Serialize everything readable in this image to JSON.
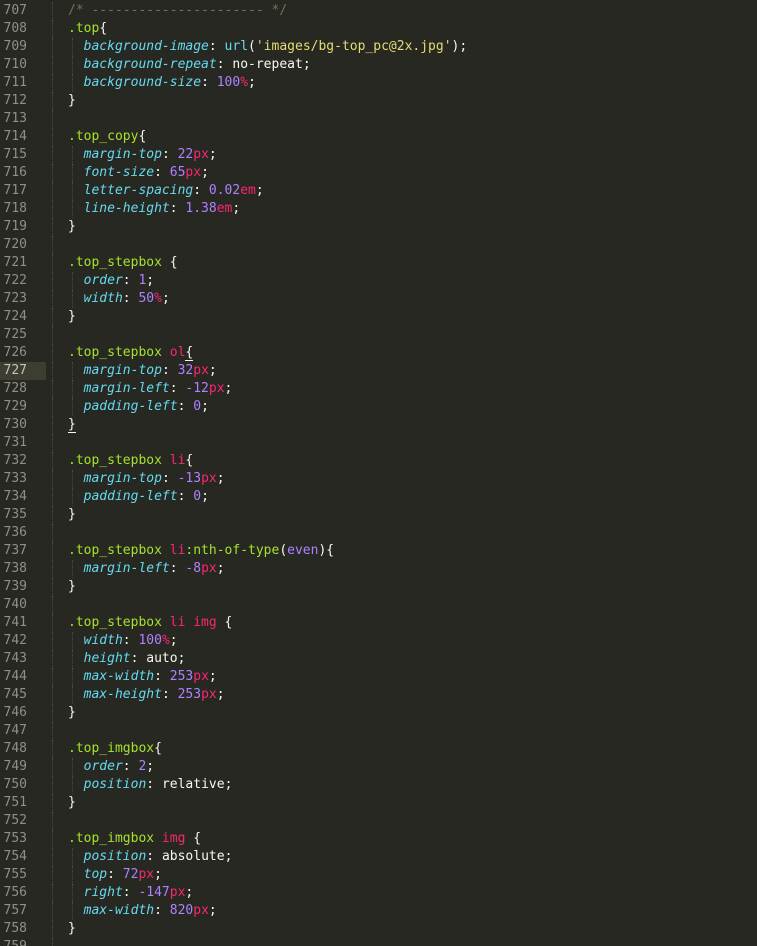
{
  "editor": {
    "colors": {
      "background": "#272822",
      "gutter_text": "#90908a",
      "active_line": "#3e3d32",
      "comment": "#75715e",
      "selector": "#a6e22e",
      "tag": "#f92672",
      "property": "#66d9ef",
      "number": "#ae81ff",
      "unit": "#f92672",
      "string": "#e6db74",
      "text": "#f8f8f2"
    },
    "active_line": 727,
    "lines": [
      {
        "n": "707",
        "tokens": [
          [
            "cm",
            "/* ---------------------- */"
          ]
        ]
      },
      {
        "n": "708",
        "tokens": [
          [
            "sel",
            ".top"
          ],
          [
            "p",
            "{"
          ]
        ]
      },
      {
        "n": "709",
        "tokens": [
          [
            "sp",
            "  "
          ],
          [
            "prop",
            "background-image"
          ],
          [
            "p",
            ": "
          ],
          [
            "fn",
            "url"
          ],
          [
            "p",
            "("
          ],
          [
            "str",
            "'images/bg-top_pc@2x.jpg'"
          ],
          [
            "p",
            ");"
          ]
        ]
      },
      {
        "n": "710",
        "tokens": [
          [
            "sp",
            "  "
          ],
          [
            "prop",
            "background-repeat"
          ],
          [
            "p",
            ": "
          ],
          [
            "val",
            "no-repeat"
          ],
          [
            "p",
            ";"
          ]
        ]
      },
      {
        "n": "711",
        "tokens": [
          [
            "sp",
            "  "
          ],
          [
            "prop",
            "background-size"
          ],
          [
            "p",
            ": "
          ],
          [
            "num",
            "100"
          ],
          [
            "unit",
            "%"
          ],
          [
            "p",
            ";"
          ]
        ]
      },
      {
        "n": "712",
        "tokens": [
          [
            "p",
            "}"
          ]
        ]
      },
      {
        "n": "713",
        "tokens": []
      },
      {
        "n": "714",
        "tokens": [
          [
            "sel",
            ".top_copy"
          ],
          [
            "p",
            "{"
          ]
        ]
      },
      {
        "n": "715",
        "tokens": [
          [
            "sp",
            "  "
          ],
          [
            "prop",
            "margin-top"
          ],
          [
            "p",
            ": "
          ],
          [
            "num",
            "22"
          ],
          [
            "unit",
            "px"
          ],
          [
            "p",
            ";"
          ]
        ]
      },
      {
        "n": "716",
        "tokens": [
          [
            "sp",
            "  "
          ],
          [
            "prop",
            "font-size"
          ],
          [
            "p",
            ": "
          ],
          [
            "num",
            "65"
          ],
          [
            "unit",
            "px"
          ],
          [
            "p",
            ";"
          ]
        ]
      },
      {
        "n": "717",
        "tokens": [
          [
            "sp",
            "  "
          ],
          [
            "prop",
            "letter-spacing"
          ],
          [
            "p",
            ": "
          ],
          [
            "num",
            "0.02"
          ],
          [
            "unit",
            "em"
          ],
          [
            "p",
            ";"
          ]
        ]
      },
      {
        "n": "718",
        "tokens": [
          [
            "sp",
            "  "
          ],
          [
            "prop",
            "line-height"
          ],
          [
            "p",
            ": "
          ],
          [
            "num",
            "1.38"
          ],
          [
            "unit",
            "em"
          ],
          [
            "p",
            ";"
          ]
        ]
      },
      {
        "n": "719",
        "tokens": [
          [
            "p",
            "}"
          ]
        ]
      },
      {
        "n": "720",
        "tokens": []
      },
      {
        "n": "721",
        "tokens": [
          [
            "sel",
            ".top_stepbox"
          ],
          [
            "p",
            " {"
          ]
        ]
      },
      {
        "n": "722",
        "tokens": [
          [
            "sp",
            "  "
          ],
          [
            "prop",
            "order"
          ],
          [
            "p",
            ": "
          ],
          [
            "num",
            "1"
          ],
          [
            "p",
            ";"
          ]
        ]
      },
      {
        "n": "723",
        "tokens": [
          [
            "sp",
            "  "
          ],
          [
            "prop",
            "width"
          ],
          [
            "p",
            ": "
          ],
          [
            "num",
            "50"
          ],
          [
            "unit",
            "%"
          ],
          [
            "p",
            ";"
          ]
        ]
      },
      {
        "n": "724",
        "tokens": [
          [
            "p",
            "}"
          ]
        ]
      },
      {
        "n": "725",
        "tokens": []
      },
      {
        "n": "726",
        "tokens": [
          [
            "sel",
            ".top_stepbox"
          ],
          [
            "p",
            " "
          ],
          [
            "tag",
            "ol"
          ],
          [
            "hl",
            "{"
          ]
        ]
      },
      {
        "n": "727",
        "tokens": [
          [
            "sp",
            "  "
          ],
          [
            "prop",
            "margin-top"
          ],
          [
            "p",
            ": "
          ],
          [
            "num",
            "32"
          ],
          [
            "unit",
            "px"
          ],
          [
            "p",
            ";"
          ]
        ]
      },
      {
        "n": "728",
        "tokens": [
          [
            "sp",
            "  "
          ],
          [
            "prop",
            "margin-left"
          ],
          [
            "p",
            ": "
          ],
          [
            "num",
            "-12"
          ],
          [
            "unit",
            "px"
          ],
          [
            "p",
            ";"
          ]
        ]
      },
      {
        "n": "729",
        "tokens": [
          [
            "sp",
            "  "
          ],
          [
            "prop",
            "padding-left"
          ],
          [
            "p",
            ": "
          ],
          [
            "num",
            "0"
          ],
          [
            "p",
            ";"
          ]
        ]
      },
      {
        "n": "730",
        "tokens": [
          [
            "hl",
            "}"
          ]
        ]
      },
      {
        "n": "731",
        "tokens": []
      },
      {
        "n": "732",
        "tokens": [
          [
            "sel",
            ".top_stepbox"
          ],
          [
            "p",
            " "
          ],
          [
            "tag",
            "li"
          ],
          [
            "p",
            "{"
          ]
        ]
      },
      {
        "n": "733",
        "tokens": [
          [
            "sp",
            "  "
          ],
          [
            "prop",
            "margin-top"
          ],
          [
            "p",
            ": "
          ],
          [
            "num",
            "-13"
          ],
          [
            "unit",
            "px"
          ],
          [
            "p",
            ";"
          ]
        ]
      },
      {
        "n": "734",
        "tokens": [
          [
            "sp",
            "  "
          ],
          [
            "prop",
            "padding-left"
          ],
          [
            "p",
            ": "
          ],
          [
            "num",
            "0"
          ],
          [
            "p",
            ";"
          ]
        ]
      },
      {
        "n": "735",
        "tokens": [
          [
            "p",
            "}"
          ]
        ]
      },
      {
        "n": "736",
        "tokens": []
      },
      {
        "n": "737",
        "tokens": [
          [
            "sel",
            ".top_stepbox"
          ],
          [
            "p",
            " "
          ],
          [
            "tag",
            "li"
          ],
          [
            "sel",
            ":nth-of-type"
          ],
          [
            "p",
            "("
          ],
          [
            "kw",
            "even"
          ],
          [
            "p",
            "){"
          ]
        ]
      },
      {
        "n": "738",
        "tokens": [
          [
            "sp",
            "  "
          ],
          [
            "prop",
            "margin-left"
          ],
          [
            "p",
            ": "
          ],
          [
            "num",
            "-8"
          ],
          [
            "unit",
            "px"
          ],
          [
            "p",
            ";"
          ]
        ]
      },
      {
        "n": "739",
        "tokens": [
          [
            "p",
            "}"
          ]
        ]
      },
      {
        "n": "740",
        "tokens": []
      },
      {
        "n": "741",
        "tokens": [
          [
            "sel",
            ".top_stepbox"
          ],
          [
            "p",
            " "
          ],
          [
            "tag",
            "li"
          ],
          [
            "p",
            " "
          ],
          [
            "tag",
            "img"
          ],
          [
            "p",
            " {"
          ]
        ]
      },
      {
        "n": "742",
        "tokens": [
          [
            "sp",
            "  "
          ],
          [
            "prop",
            "width"
          ],
          [
            "p",
            ": "
          ],
          [
            "num",
            "100"
          ],
          [
            "unit",
            "%"
          ],
          [
            "p",
            ";"
          ]
        ]
      },
      {
        "n": "743",
        "tokens": [
          [
            "sp",
            "  "
          ],
          [
            "prop",
            "height"
          ],
          [
            "p",
            ": "
          ],
          [
            "val",
            "auto"
          ],
          [
            "p",
            ";"
          ]
        ]
      },
      {
        "n": "744",
        "tokens": [
          [
            "sp",
            "  "
          ],
          [
            "prop",
            "max-width"
          ],
          [
            "p",
            ": "
          ],
          [
            "num",
            "253"
          ],
          [
            "unit",
            "px"
          ],
          [
            "p",
            ";"
          ]
        ]
      },
      {
        "n": "745",
        "tokens": [
          [
            "sp",
            "  "
          ],
          [
            "prop",
            "max-height"
          ],
          [
            "p",
            ": "
          ],
          [
            "num",
            "253"
          ],
          [
            "unit",
            "px"
          ],
          [
            "p",
            ";"
          ]
        ]
      },
      {
        "n": "746",
        "tokens": [
          [
            "p",
            "}"
          ]
        ]
      },
      {
        "n": "747",
        "tokens": []
      },
      {
        "n": "748",
        "tokens": [
          [
            "sel",
            ".top_imgbox"
          ],
          [
            "p",
            "{"
          ]
        ]
      },
      {
        "n": "749",
        "tokens": [
          [
            "sp",
            "  "
          ],
          [
            "prop",
            "order"
          ],
          [
            "p",
            ": "
          ],
          [
            "num",
            "2"
          ],
          [
            "p",
            ";"
          ]
        ]
      },
      {
        "n": "750",
        "tokens": [
          [
            "sp",
            "  "
          ],
          [
            "prop",
            "position"
          ],
          [
            "p",
            ": "
          ],
          [
            "val",
            "relative"
          ],
          [
            "p",
            ";"
          ]
        ]
      },
      {
        "n": "751",
        "tokens": [
          [
            "p",
            "}"
          ]
        ]
      },
      {
        "n": "752",
        "tokens": []
      },
      {
        "n": "753",
        "tokens": [
          [
            "sel",
            ".top_imgbox"
          ],
          [
            "p",
            " "
          ],
          [
            "tag",
            "img"
          ],
          [
            "p",
            " {"
          ]
        ]
      },
      {
        "n": "754",
        "tokens": [
          [
            "sp",
            "  "
          ],
          [
            "prop",
            "position"
          ],
          [
            "p",
            ": "
          ],
          [
            "val",
            "absolute"
          ],
          [
            "p",
            ";"
          ]
        ]
      },
      {
        "n": "755",
        "tokens": [
          [
            "sp",
            "  "
          ],
          [
            "prop",
            "top"
          ],
          [
            "p",
            ": "
          ],
          [
            "num",
            "72"
          ],
          [
            "unit",
            "px"
          ],
          [
            "p",
            ";"
          ]
        ]
      },
      {
        "n": "756",
        "tokens": [
          [
            "sp",
            "  "
          ],
          [
            "prop",
            "right"
          ],
          [
            "p",
            ": "
          ],
          [
            "num",
            "-147"
          ],
          [
            "unit",
            "px"
          ],
          [
            "p",
            ";"
          ]
        ]
      },
      {
        "n": "757",
        "tokens": [
          [
            "sp",
            "  "
          ],
          [
            "prop",
            "max-width"
          ],
          [
            "p",
            ": "
          ],
          [
            "num",
            "820"
          ],
          [
            "unit",
            "px"
          ],
          [
            "p",
            ";"
          ]
        ]
      },
      {
        "n": "758",
        "tokens": [
          [
            "p",
            "}"
          ]
        ]
      },
      {
        "n": "759",
        "tokens": []
      }
    ]
  }
}
